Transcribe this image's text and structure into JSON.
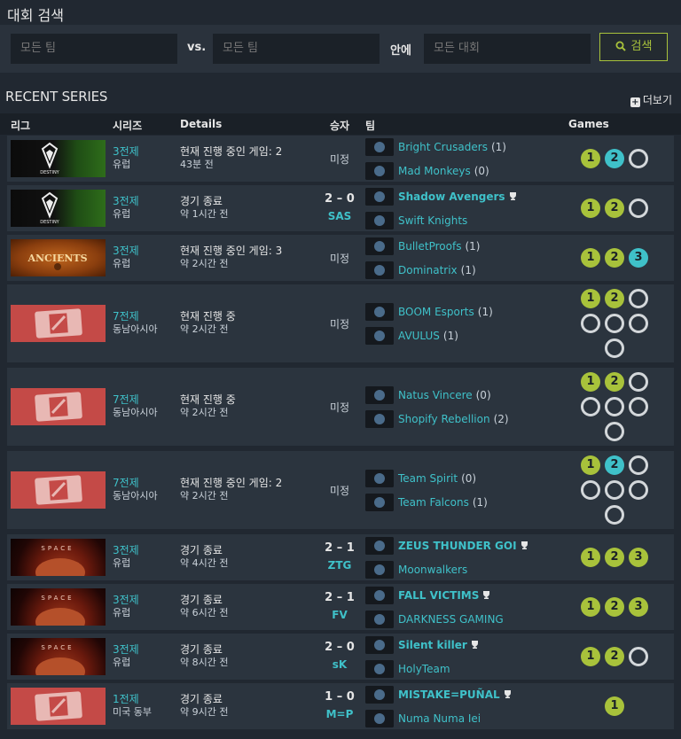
{
  "search": {
    "title": "대회 검색",
    "team1_placeholder": "모든 팀",
    "vs_label": "vs.",
    "team2_placeholder": "모든 팀",
    "in_label": "안에",
    "league_placeholder": "모든 대회",
    "button_label": "검색"
  },
  "section": {
    "title": "RECENT SERIES",
    "more_label": "더보기"
  },
  "columns": {
    "league": "리그",
    "series": "시리즈",
    "details": "Details",
    "winner": "승자",
    "teams": "팀",
    "games": "Games"
  },
  "colors": {
    "accent_green": "#a8c23b",
    "accent_teal": "#3fc1c9"
  },
  "rows": [
    {
      "logo": "destiny",
      "series": "3전제",
      "region": "유럽",
      "status": "현재 진행 중인 게임: 2",
      "time": "43분 전",
      "winner": "미정",
      "score": "",
      "abbr": "",
      "team1": {
        "name": "Bright Crusaders",
        "wins": "(1)",
        "icon": "crusader-icon"
      },
      "team2": {
        "name": "Mad Monkeys",
        "wins": "(0)",
        "icon": "monkey-icon"
      },
      "games": [
        "1",
        "2",
        ""
      ]
    },
    {
      "logo": "destiny",
      "series": "3전제",
      "region": "유럽",
      "status": "경기 종료",
      "time": "약 1시간 전",
      "winner": "",
      "score": "2 – 0",
      "abbr": "SAS",
      "team1": {
        "name": "Shadow Avengers",
        "wins": "",
        "icon": "avengers-icon"
      },
      "team2": {
        "name": "Swift Knights",
        "wins": "",
        "icon": "knights-icon"
      },
      "games": [
        "1",
        "2",
        ""
      ]
    },
    {
      "logo": "ancients",
      "series": "3전제",
      "region": "유럽",
      "status": "현재 진행 중인 게임: 3",
      "time": "약 2시간 전",
      "winner": "미정",
      "score": "",
      "abbr": "",
      "team1": {
        "name": "BulletProofs",
        "wins": "(1)",
        "icon": "bulletproofs-icon"
      },
      "team2": {
        "name": "Dominatrix",
        "wins": "(1)",
        "icon": "dominatrix-icon"
      },
      "games": [
        "1",
        "2",
        "3"
      ]
    },
    {
      "logo": "dota",
      "series": "7전제",
      "region": "동남아시아",
      "status": "현재 진행 중",
      "time": "약 2시간 전",
      "winner": "미정",
      "score": "",
      "abbr": "",
      "team1": {
        "name": "BOOM Esports",
        "wins": "(1)",
        "icon": "boom-icon"
      },
      "team2": {
        "name": "AVULUS",
        "wins": "(1)",
        "icon": "avulus-icon"
      },
      "games": [
        "1",
        "2",
        "",
        "",
        "",
        "",
        ""
      ]
    },
    {
      "logo": "dota",
      "series": "7전제",
      "region": "동남아시아",
      "status": "현재 진행 중",
      "time": "약 2시간 전",
      "winner": "미정",
      "score": "",
      "abbr": "",
      "team1": {
        "name": "Natus Vincere",
        "wins": "(0)",
        "icon": "navi-icon"
      },
      "team2": {
        "name": "Shopify Rebellion",
        "wins": "(2)",
        "icon": "shopify-icon"
      },
      "games": [
        "1",
        "2",
        "",
        "",
        "",
        "",
        ""
      ]
    },
    {
      "logo": "dota",
      "series": "7전제",
      "region": "동남아시아",
      "status": "현재 진행 중인 게임: 2",
      "time": "약 2시간 전",
      "winner": "미정",
      "score": "",
      "abbr": "",
      "team1": {
        "name": "Team Spirit",
        "wins": "(0)",
        "icon": "spirit-icon"
      },
      "team2": {
        "name": "Team Falcons",
        "wins": "(1)",
        "icon": "falcons-icon"
      },
      "games": [
        "1",
        "2",
        "",
        "",
        "",
        "",
        ""
      ]
    },
    {
      "logo": "space",
      "series": "3전제",
      "region": "유럽",
      "status": "경기 종료",
      "time": "약 4시간 전",
      "winner": "",
      "score": "2 – 1",
      "abbr": "ZTG",
      "team1": {
        "name": "ZEUS THUNDER GOI",
        "wins": "",
        "icon": "zeus-icon"
      },
      "team2": {
        "name": "Moonwalkers",
        "wins": "",
        "icon": "moonwalkers-icon"
      },
      "games": [
        "1",
        "2",
        "3"
      ]
    },
    {
      "logo": "space",
      "series": "3전제",
      "region": "유럽",
      "status": "경기 종료",
      "time": "약 6시간 전",
      "winner": "",
      "score": "2 – 1",
      "abbr": "FV",
      "team1": {
        "name": "FALL VICTIMS",
        "wins": "",
        "icon": "fallvictims-icon"
      },
      "team2": {
        "name": "DARKNESS GAMING",
        "wins": "",
        "icon": "darkness-icon"
      },
      "games": [
        "1",
        "2",
        "3"
      ]
    },
    {
      "logo": "space",
      "series": "3전제",
      "region": "유럽",
      "status": "경기 종료",
      "time": "약 8시간 전",
      "winner": "",
      "score": "2 – 0",
      "abbr": "sK",
      "team1": {
        "name": "Silent killer",
        "wins": "",
        "icon": "silentkiller-icon"
      },
      "team2": {
        "name": "HolyTeam",
        "wins": "",
        "icon": "holyteam-icon"
      },
      "games": [
        "1",
        "2",
        ""
      ]
    },
    {
      "logo": "dota",
      "series": "1전제",
      "region": "미국 동부",
      "status": "경기 종료",
      "time": "약 9시간 전",
      "winner": "",
      "score": "1 – 0",
      "abbr": "M=P",
      "team1": {
        "name": "MISTAKE=PUÑAL",
        "wins": "",
        "icon": "mistake-icon"
      },
      "team2": {
        "name": "Numa Numa Iei",
        "wins": "",
        "icon": "numa-icon"
      },
      "games": [
        "1"
      ]
    }
  ]
}
